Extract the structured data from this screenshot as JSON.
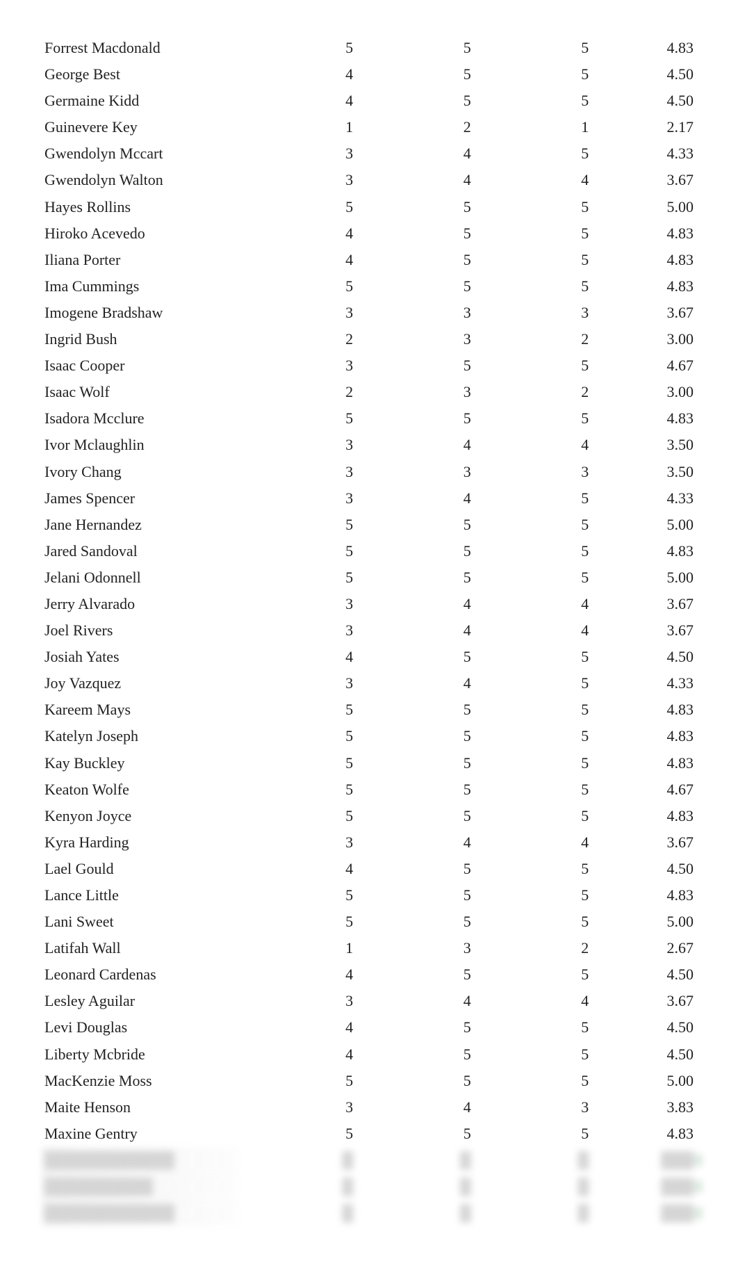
{
  "rows": [
    {
      "name": "Forrest Macdonald",
      "c1": "5",
      "c2": "5",
      "c3": "5",
      "c4": "4.83"
    },
    {
      "name": "George Best",
      "c1": "4",
      "c2": "5",
      "c3": "5",
      "c4": "4.50"
    },
    {
      "name": "Germaine Kidd",
      "c1": "4",
      "c2": "5",
      "c3": "5",
      "c4": "4.50"
    },
    {
      "name": "Guinevere Key",
      "c1": "1",
      "c2": "2",
      "c3": "1",
      "c4": "2.17"
    },
    {
      "name": "Gwendolyn Mccart",
      "c1": "3",
      "c2": "4",
      "c3": "5",
      "c4": "4.33"
    },
    {
      "name": "Gwendolyn Walton",
      "c1": "3",
      "c2": "4",
      "c3": "4",
      "c4": "3.67"
    },
    {
      "name": "Hayes Rollins",
      "c1": "5",
      "c2": "5",
      "c3": "5",
      "c4": "5.00"
    },
    {
      "name": "Hiroko Acevedo",
      "c1": "4",
      "c2": "5",
      "c3": "5",
      "c4": "4.83"
    },
    {
      "name": "Iliana Porter",
      "c1": "4",
      "c2": "5",
      "c3": "5",
      "c4": "4.83"
    },
    {
      "name": "Ima Cummings",
      "c1": "5",
      "c2": "5",
      "c3": "5",
      "c4": "4.83"
    },
    {
      "name": "Imogene Bradshaw",
      "c1": "3",
      "c2": "3",
      "c3": "3",
      "c4": "3.67"
    },
    {
      "name": "Ingrid Bush",
      "c1": "2",
      "c2": "3",
      "c3": "2",
      "c4": "3.00"
    },
    {
      "name": "Isaac Cooper",
      "c1": "3",
      "c2": "5",
      "c3": "5",
      "c4": "4.67"
    },
    {
      "name": "Isaac Wolf",
      "c1": "2",
      "c2": "3",
      "c3": "2",
      "c4": "3.00"
    },
    {
      "name": "Isadora Mcclure",
      "c1": "5",
      "c2": "5",
      "c3": "5",
      "c4": "4.83"
    },
    {
      "name": "Ivor Mclaughlin",
      "c1": "3",
      "c2": "4",
      "c3": "4",
      "c4": "3.50"
    },
    {
      "name": "Ivory Chang",
      "c1": "3",
      "c2": "3",
      "c3": "3",
      "c4": "3.50"
    },
    {
      "name": "James Spencer",
      "c1": "3",
      "c2": "4",
      "c3": "5",
      "c4": "4.33"
    },
    {
      "name": "Jane Hernandez",
      "c1": "5",
      "c2": "5",
      "c3": "5",
      "c4": "5.00"
    },
    {
      "name": "Jared Sandoval",
      "c1": "5",
      "c2": "5",
      "c3": "5",
      "c4": "4.83"
    },
    {
      "name": "Jelani Odonnell",
      "c1": "5",
      "c2": "5",
      "c3": "5",
      "c4": "5.00"
    },
    {
      "name": "Jerry Alvarado",
      "c1": "3",
      "c2": "4",
      "c3": "4",
      "c4": "3.67"
    },
    {
      "name": "Joel Rivers",
      "c1": "3",
      "c2": "4",
      "c3": "4",
      "c4": "3.67"
    },
    {
      "name": "Josiah Yates",
      "c1": "4",
      "c2": "5",
      "c3": "5",
      "c4": "4.50"
    },
    {
      "name": "Joy Vazquez",
      "c1": "3",
      "c2": "4",
      "c3": "5",
      "c4": "4.33"
    },
    {
      "name": "Kareem Mays",
      "c1": "5",
      "c2": "5",
      "c3": "5",
      "c4": "4.83"
    },
    {
      "name": "Katelyn Joseph",
      "c1": "5",
      "c2": "5",
      "c3": "5",
      "c4": "4.83"
    },
    {
      "name": "Kay Buckley",
      "c1": "5",
      "c2": "5",
      "c3": "5",
      "c4": "4.83"
    },
    {
      "name": "Keaton Wolfe",
      "c1": "5",
      "c2": "5",
      "c3": "5",
      "c4": "4.67"
    },
    {
      "name": "Kenyon Joyce",
      "c1": "5",
      "c2": "5",
      "c3": "5",
      "c4": "4.83"
    },
    {
      "name": "Kyra Harding",
      "c1": "3",
      "c2": "4",
      "c3": "4",
      "c4": "3.67"
    },
    {
      "name": "Lael Gould",
      "c1": "4",
      "c2": "5",
      "c3": "5",
      "c4": "4.50"
    },
    {
      "name": "Lance Little",
      "c1": "5",
      "c2": "5",
      "c3": "5",
      "c4": "4.83"
    },
    {
      "name": "Lani Sweet",
      "c1": "5",
      "c2": "5",
      "c3": "5",
      "c4": "5.00"
    },
    {
      "name": "Latifah Wall",
      "c1": "1",
      "c2": "3",
      "c3": "2",
      "c4": "2.67"
    },
    {
      "name": "Leonard Cardenas",
      "c1": "4",
      "c2": "5",
      "c3": "5",
      "c4": "4.50"
    },
    {
      "name": "Lesley Aguilar",
      "c1": "3",
      "c2": "4",
      "c3": "4",
      "c4": "3.67"
    },
    {
      "name": "Levi Douglas",
      "c1": "4",
      "c2": "5",
      "c3": "5",
      "c4": "4.50"
    },
    {
      "name": "Liberty Mcbride",
      "c1": "4",
      "c2": "5",
      "c3": "5",
      "c4": "4.50"
    },
    {
      "name": "MacKenzie Moss",
      "c1": "5",
      "c2": "5",
      "c3": "5",
      "c4": "5.00"
    },
    {
      "name": "Maite Henson",
      "c1": "3",
      "c2": "4",
      "c3": "3",
      "c4": "3.83"
    },
    {
      "name": "Maxine Gentry",
      "c1": "5",
      "c2": "5",
      "c3": "5",
      "c4": "4.83"
    }
  ],
  "blurred_rows": [
    {
      "name": "████████████",
      "c1": "█",
      "c2": "█",
      "c3": "█",
      "c4": "███"
    },
    {
      "name": "██████████",
      "c1": "█",
      "c2": "█",
      "c3": "█",
      "c4": "███"
    },
    {
      "name": "████████████",
      "c1": "█",
      "c2": "█",
      "c3": "█",
      "c4": "███"
    }
  ]
}
